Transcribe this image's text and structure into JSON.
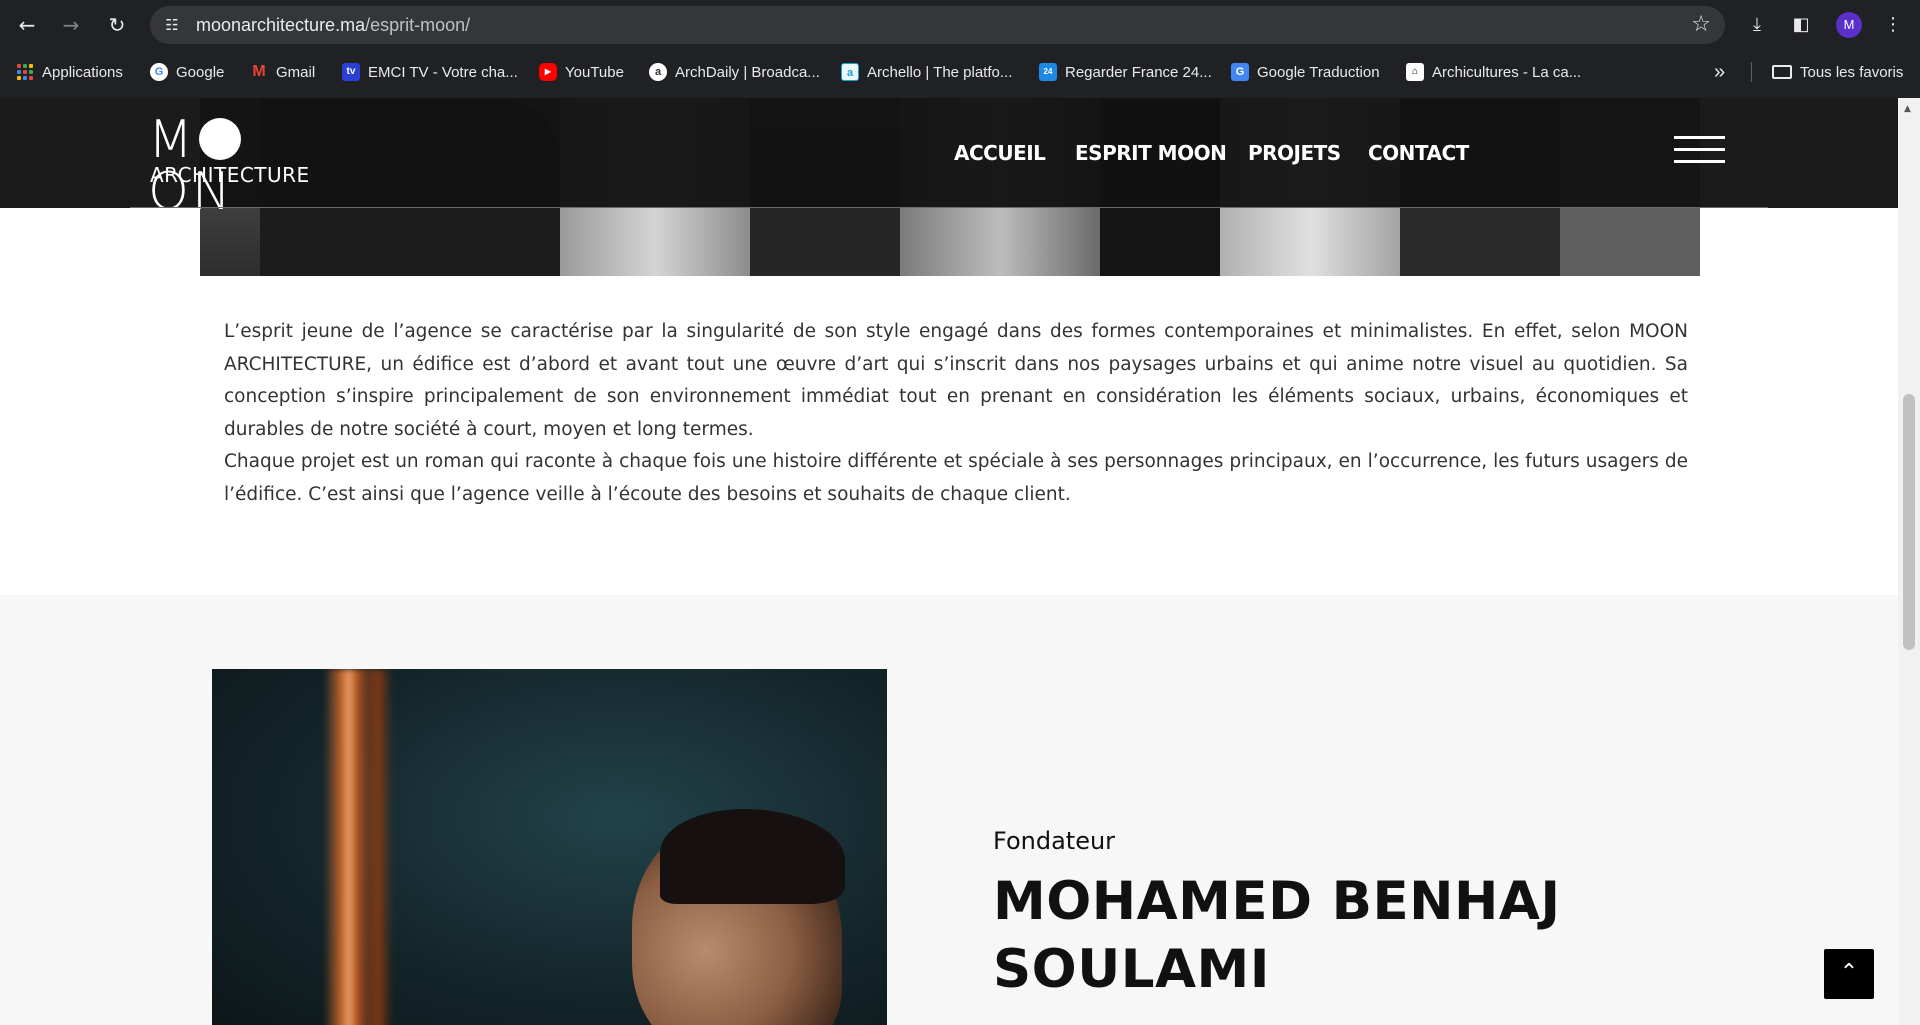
{
  "browser": {
    "url_domain": "moonarchitecture.ma",
    "url_path": "/esprit-moon/",
    "profile_initial": "M",
    "icons": {
      "back": "back-arrow-icon",
      "forward": "forward-arrow-icon",
      "reload": "reload-icon",
      "site_info": "site-info-icon",
      "bookmark_star": "star-icon",
      "downloads": "download-icon",
      "side_panel": "side-panel-icon",
      "menu": "more-vert-icon"
    }
  },
  "bookmarks": {
    "items": [
      {
        "label": "Applications",
        "icon": "apps-grid-icon"
      },
      {
        "label": "Google",
        "icon": "google-icon",
        "glyph": "G"
      },
      {
        "label": "Gmail",
        "icon": "gmail-icon",
        "glyph": "M"
      },
      {
        "label": "EMCI TV - Votre cha...",
        "icon": "emci-icon",
        "glyph": "tv"
      },
      {
        "label": "YouTube",
        "icon": "youtube-icon",
        "glyph": "▶"
      },
      {
        "label": "ArchDaily | Broadca...",
        "icon": "archdaily-icon",
        "glyph": "a"
      },
      {
        "label": "Archello | The platfo...",
        "icon": "archello-icon",
        "glyph": "a"
      },
      {
        "label": "Regarder France 24...",
        "icon": "france24-icon",
        "glyph": "24"
      },
      {
        "label": "Google Traduction",
        "icon": "translate-icon",
        "glyph": "G"
      },
      {
        "label": "Archicultures - La ca...",
        "icon": "archicultures-icon",
        "glyph": "⌂"
      }
    ],
    "overflow_glyph": "»",
    "all_bookmarks": "Tous les favoris"
  },
  "site": {
    "logo": {
      "top": "M",
      "bottom_rest": "ON",
      "sub": "ARCHITECTURE"
    },
    "menu": [
      "ACCUEIL",
      "ESPRIT MOON",
      "PROJETS",
      "CONTACT"
    ],
    "intro": [
      "L’esprit jeune de l’agence se caractérise par la singularité de son style engagé dans des formes contemporaines et minimalistes. En effet, selon MOON ARCHITECTURE, un édifice est d’abord et avant tout une œuvre d’art qui s’inscrit dans nos paysages urbains et qui anime notre visuel au quotidien. Sa conception s’inspire principalement de son environnement immédiat tout en prenant en considération les éléments sociaux, urbains, économiques et durables de notre société à court, moyen et long termes.",
      "Chaque projet est un roman qui raconte à chaque fois une histoire différente et spéciale à ses personnages principaux, en l’occurrence, les futurs usagers de l’édifice. C’est ainsi que l’agence veille à l’écoute des besoins et souhaits de chaque client."
    ],
    "founder": {
      "role": "Fondateur",
      "name_line1": "MOHAMED BENHAJ",
      "name_line2": "SOULAMI"
    },
    "back_to_top_glyph": "⌃"
  }
}
